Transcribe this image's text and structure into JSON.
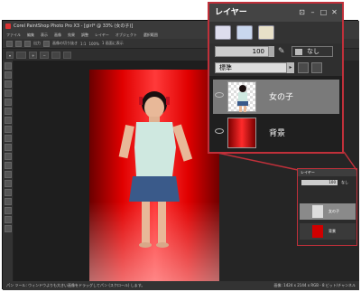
{
  "app": {
    "title": "Corel PaintShop Photo Pro X3 - [girl* @ 33% (女の子)]"
  },
  "menu": [
    "ファイル",
    "編集",
    "表示",
    "画像",
    "効果",
    "調整",
    "レイヤー",
    "オブジェクト",
    "選択範囲"
  ],
  "toolbar": {
    "buttons": [
      "出力",
      "画像の切り抜き",
      "1:1",
      "100%",
      "1 画面に表示"
    ]
  },
  "status": {
    "left": "パン ツール: ウィンドウよりも大きい画像をドラッグしてパン (スクロール) します。",
    "right": "画像: 1424 x 2144 x RGB - 8 ビット/チャンネル"
  },
  "layer_panel": {
    "title": "レイヤー",
    "opacity": "100",
    "group_label": "なし",
    "blend_mode": "標準",
    "layers": [
      {
        "name": "女の子"
      },
      {
        "name": "背景"
      }
    ]
  },
  "small_panel": {
    "title": "レイヤー",
    "opacity": "100",
    "group_label": "なし",
    "layers": [
      {
        "name": "女の子"
      },
      {
        "name": "背景"
      }
    ]
  },
  "colors": {
    "accent": "#c0303a",
    "canvas_red": "#e00000"
  }
}
